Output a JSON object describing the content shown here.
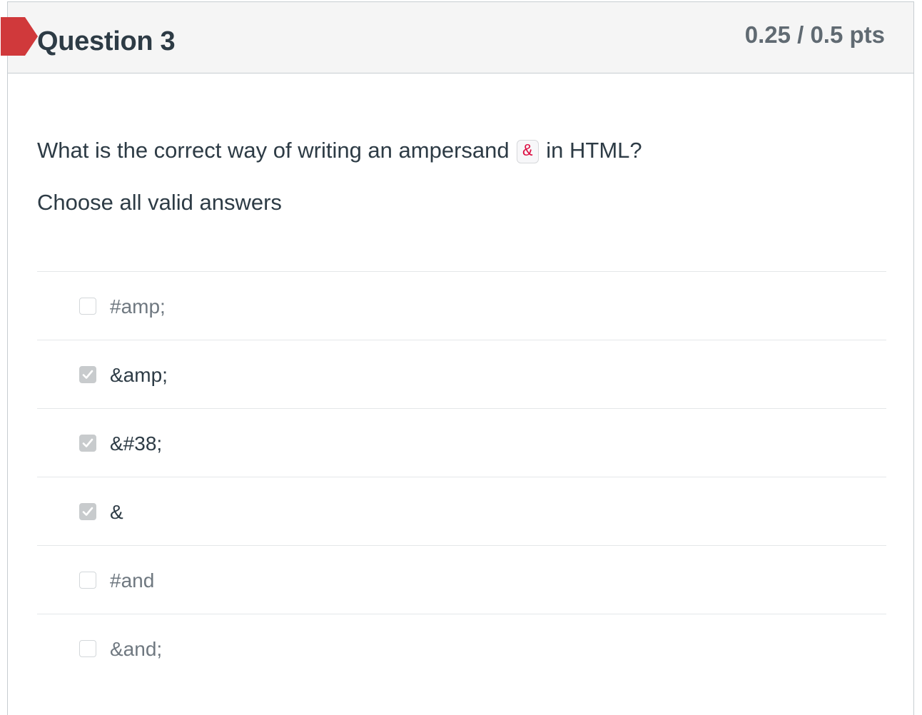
{
  "question": {
    "title": "Question 3",
    "points": "0.25 / 0.5 pts",
    "text_before": "What is the correct way of writing an ampersand",
    "code": "&",
    "text_after": "in HTML?",
    "instruction": "Choose all valid answers"
  },
  "answers": [
    {
      "label": "#amp;",
      "checked": false
    },
    {
      "label": "&amp;",
      "checked": true
    },
    {
      "label": "&#38;",
      "checked": true
    },
    {
      "label": "&",
      "checked": true
    },
    {
      "label": "#and",
      "checked": false
    },
    {
      "label": "&and;",
      "checked": false
    }
  ],
  "colors": {
    "flag": "#d0393b",
    "header_bg": "#f5f5f5",
    "text": "#2d3b45",
    "muted_text": "#6f7880",
    "code_text": "#dd1144",
    "checked_box": "#c8cbcd"
  },
  "icons": {
    "flag": "incorrect-flag-icon",
    "check": "checkmark-icon"
  }
}
